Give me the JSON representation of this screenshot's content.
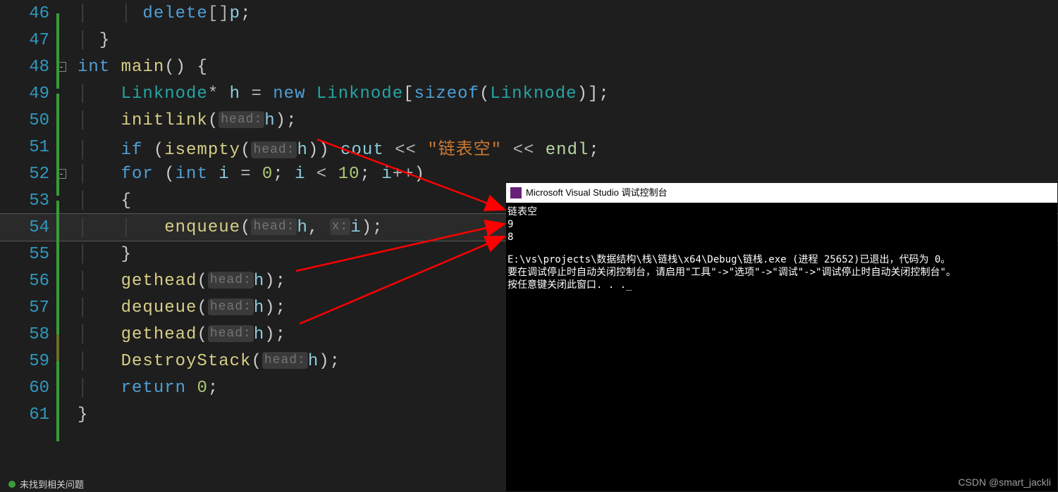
{
  "lines": {
    "46": {
      "num": "46",
      "fold": "",
      "code_html": "<span class='guide'>│   </span><span class='guide'>│ </span><span class='kw'>delete</span><span class='op'>[]</span><span class='var'>p</span><span class='p'>;</span>"
    },
    "47": {
      "num": "47",
      "fold": "",
      "code_html": "<span class='guide'>│ </span><span class='p'>}</span>"
    },
    "48": {
      "num": "48",
      "fold": "-",
      "code_html": "<span class='kw'>int</span> <span class='fn'>main</span><span class='p'>()</span> <span class='p'>{</span>"
    },
    "49": {
      "num": "49",
      "fold": "",
      "code_html": "<span class='guide'>│   </span><span class='type'>Linknode</span><span class='op'>*</span> <span class='var'>h</span> <span class='op'>=</span> <span class='kw'>new</span> <span class='type'>Linknode</span><span class='p'>[</span><span class='kw'>sizeof</span><span class='p'>(</span><span class='type'>Linknode</span><span class='p'>)]</span><span class='p'>;</span>"
    },
    "50": {
      "num": "50",
      "fold": "",
      "code_html": "<span class='guide'>│   </span><span class='fn'>initlink</span><span class='p'>(</span><span class='hint'>head:</span><span class='var'>h</span><span class='p'>)</span><span class='p'>;</span>"
    },
    "51": {
      "num": "51",
      "fold": "",
      "code_html": "<span class='guide'>│   </span><span class='kw'>if</span> <span class='p'>(</span><span class='fn'>isempty</span><span class='p'>(</span><span class='hint'>head:</span><span class='var'>h</span><span class='p'>)</span><span class='p'>)</span> <span class='var'>cout</span> <span class='op'>&lt;&lt;</span> <span class='str-q'>\"链表空\"</span> <span class='op'>&lt;&lt;</span> <span class='endlc'>endl</span><span class='p'>;</span>"
    },
    "52": {
      "num": "52",
      "fold": "-",
      "code_html": "<span class='guide'>│   </span><span class='kw'>for</span> <span class='p'>(</span><span class='kw'>int</span> <span class='var'>i</span> <span class='op'>=</span> <span class='num'>0</span><span class='p'>;</span> <span class='var'>i</span> <span class='op'>&lt;</span> <span class='num'>10</span><span class='p'>;</span> <span class='var'>i</span><span class='op'>++</span><span class='p'>)</span>"
    },
    "53": {
      "num": "53",
      "fold": "",
      "code_html": "<span class='guide'>│   </span><span class='p'>{</span>"
    },
    "54": {
      "num": "54",
      "fold": "",
      "code_html": "<span class='guide'>│   </span><span class='guide'>│   </span><span class='fn'>enqueue</span><span class='p'>(</span><span class='hint'>head:</span><span class='var'>h</span><span class='p'>,</span> <span class='hint'>x:</span><span class='var'>i</span><span class='p'>)</span><span class='p'>;</span>"
    },
    "55": {
      "num": "55",
      "fold": "",
      "code_html": "<span class='guide'>│   </span><span class='p'>}</span>"
    },
    "56": {
      "num": "56",
      "fold": "",
      "code_html": "<span class='guide'>│   </span><span class='fn'>gethead</span><span class='p'>(</span><span class='hint'>head:</span><span class='var'>h</span><span class='p'>)</span><span class='p'>;</span>"
    },
    "57": {
      "num": "57",
      "fold": "",
      "code_html": "<span class='guide'>│   </span><span class='fn'>dequeue</span><span class='p'>(</span><span class='hint'>head:</span><span class='var'>h</span><span class='p'>)</span><span class='p'>;</span>"
    },
    "58": {
      "num": "58",
      "fold": "",
      "code_html": "<span class='guide'>│   </span><span class='fn'>gethead</span><span class='p'>(</span><span class='hint'>head:</span><span class='var'>h</span><span class='p'>)</span><span class='p'>;</span>"
    },
    "59": {
      "num": "59",
      "fold": "",
      "code_html": "<span class='guide'>│   </span><span class='fn'>DestroyStack</span><span class='p'>(</span><span class='hint'>head:</span><span class='var'>h</span><span class='p'>)</span><span class='p'>;</span>"
    },
    "60": {
      "num": "60",
      "fold": "",
      "code_html": "<span class='guide'>│   </span><span class='kw'>return</span> <span class='num'>0</span><span class='p'>;</span>"
    },
    "61": {
      "num": "61",
      "fold": "",
      "code_html": "<span class='p'>}</span>"
    }
  },
  "console": {
    "title": "Microsoft Visual Studio 调试控制台",
    "out1": "链表空",
    "out2": "9",
    "out3": "8",
    "path": "E:\\vs\\projects\\数据结构\\栈\\链栈\\x64\\Debug\\链栈.exe (进程 25652)已退出，代码为 0。",
    "tip": "要在调试停止时自动关闭控制台，请启用\"工具\"->\"选项\"->\"调试\"->\"调试停止时自动关闭控制台\"。",
    "press": "按任意键关闭此窗口. . ._"
  },
  "watermark": "CSDN @smart_jackli",
  "status": "未找到相关问题"
}
